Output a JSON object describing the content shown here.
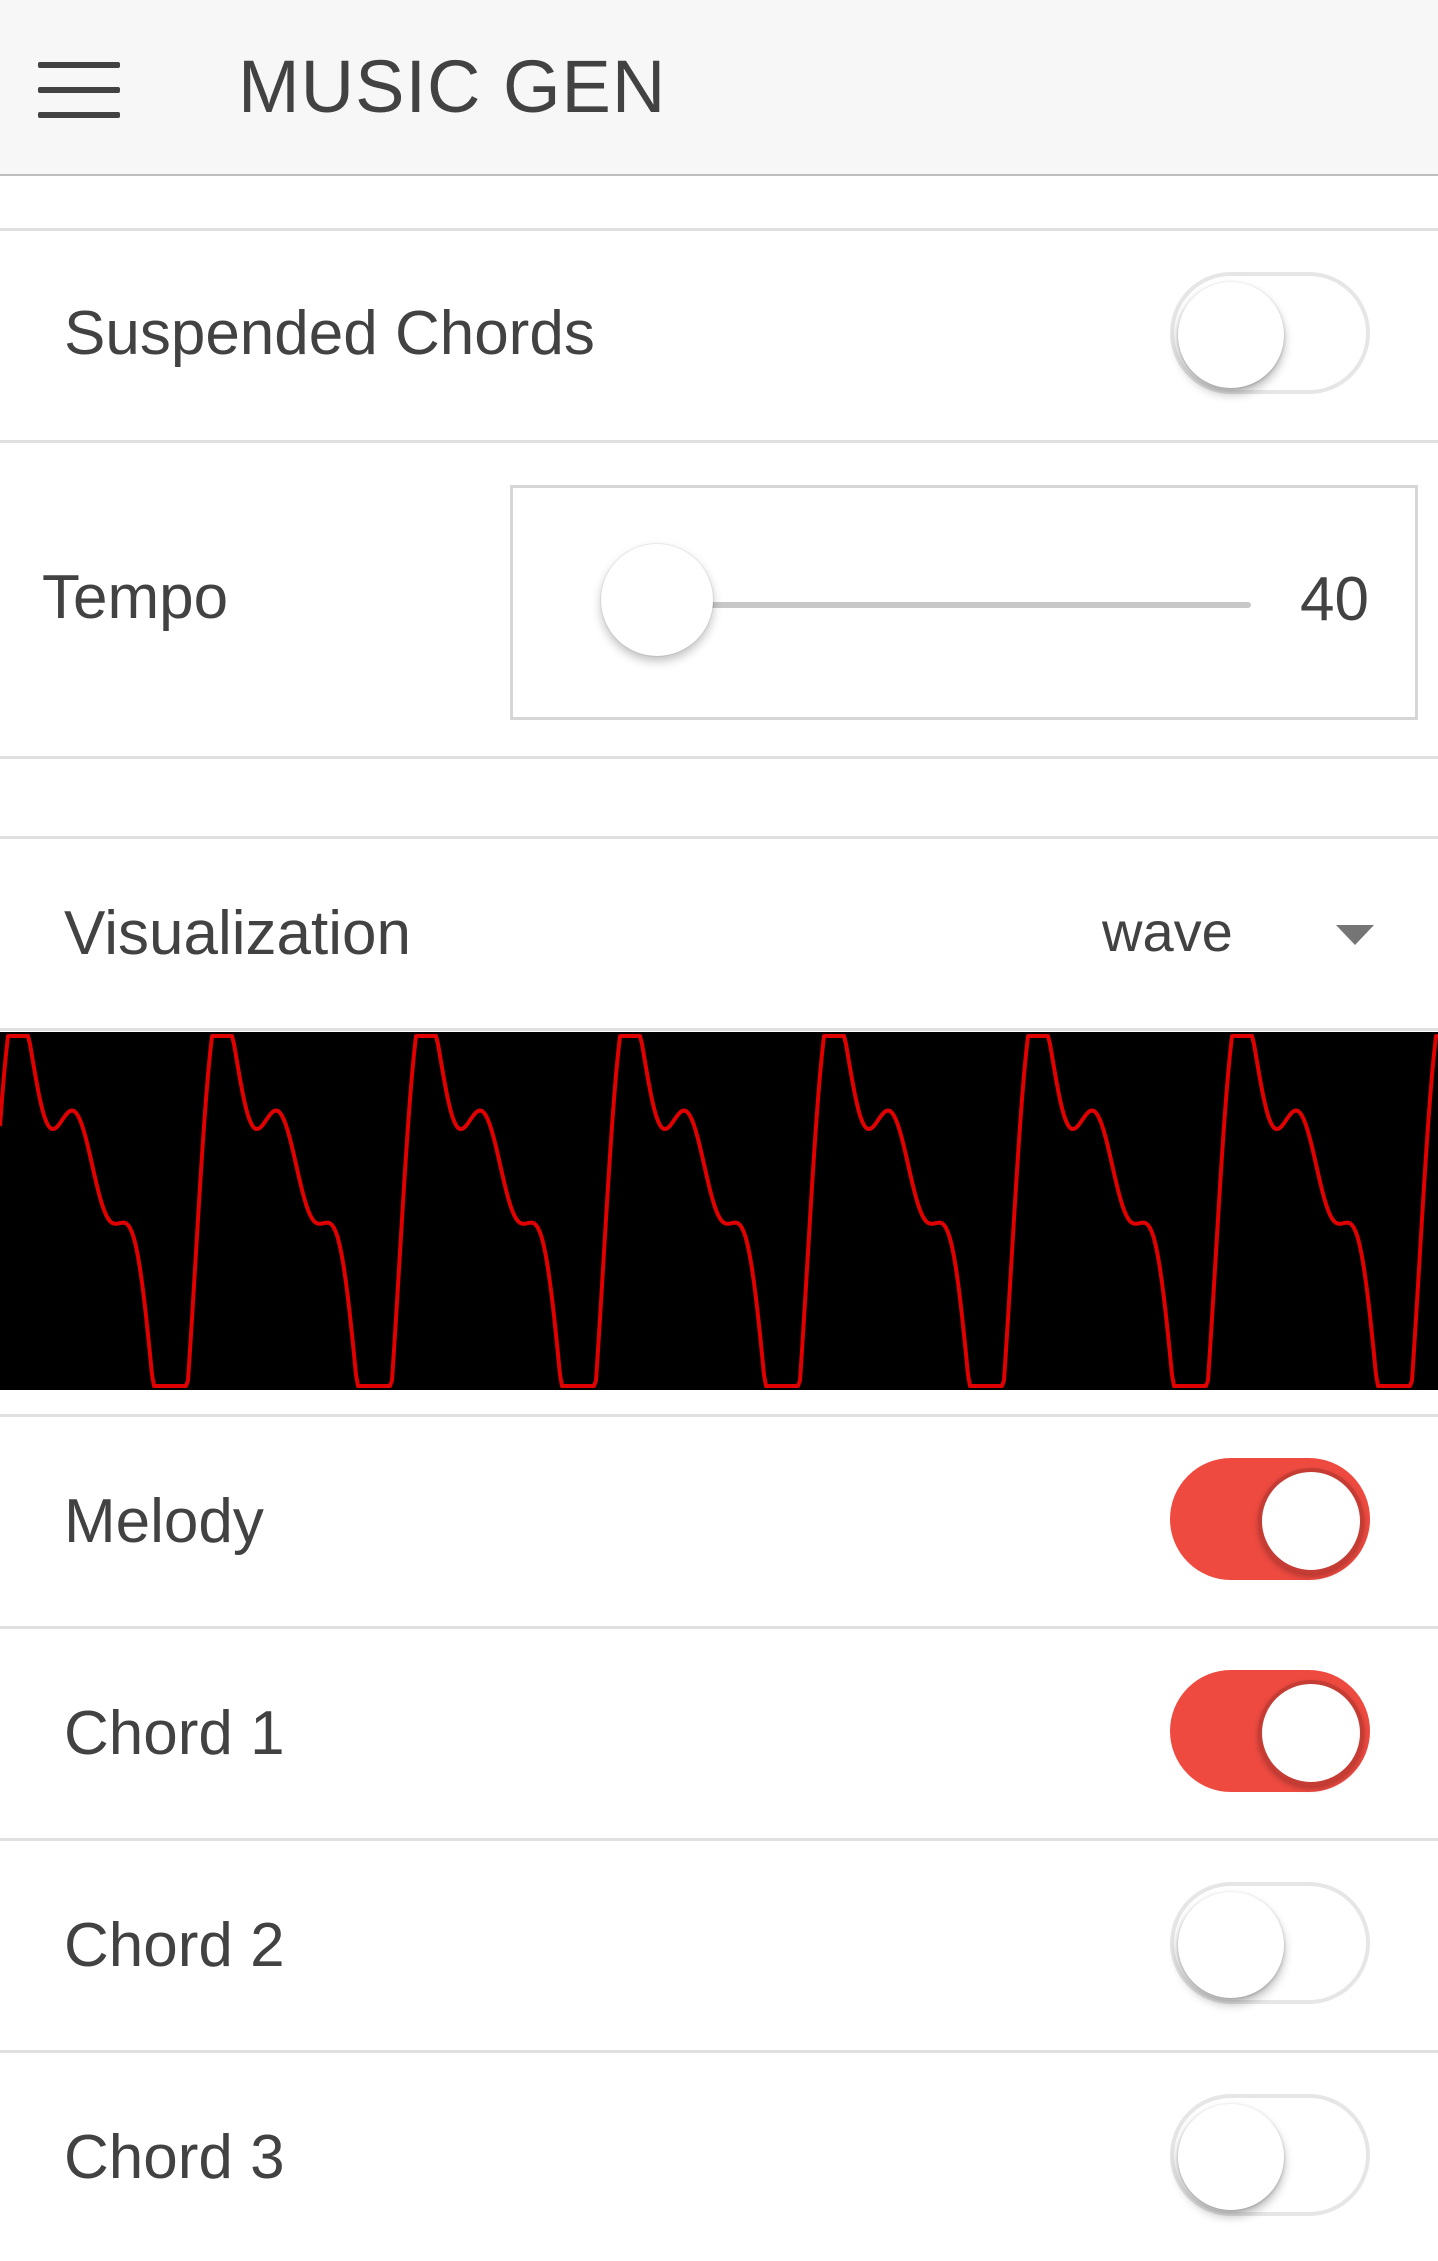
{
  "appbar": {
    "title": "MUSIC GEN"
  },
  "settings": {
    "suspended_chords": {
      "label": "Suspended Chords",
      "on": false
    },
    "tempo": {
      "label": "Tempo",
      "value": "40"
    },
    "visualization": {
      "label": "Visualization",
      "selected": "wave"
    }
  },
  "tracks": [
    {
      "label": "Melody",
      "on": true
    },
    {
      "label": "Chord 1",
      "on": true
    },
    {
      "label": "Chord 2",
      "on": false
    },
    {
      "label": "Chord 3",
      "on": false
    }
  ],
  "colors": {
    "accent": "#ee4a40",
    "wave": "#e00000",
    "wave_bg": "#000000"
  }
}
